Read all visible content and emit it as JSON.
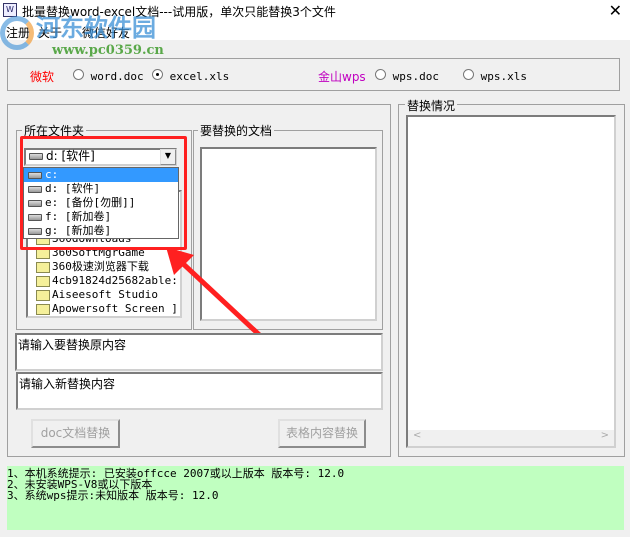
{
  "window": {
    "title": "批量替换word-excel文档---试用版，单次只能替换3个文件",
    "icon": "W",
    "close": "✕"
  },
  "watermark": {
    "name": "河东软件园",
    "url": "www.pc0359.cn"
  },
  "menu": [
    "注册",
    "关于",
    "微信好友"
  ],
  "format": {
    "ms_label": "微软",
    "wps_label": "金山wps",
    "options": [
      {
        "label": "word.doc",
        "checked": false
      },
      {
        "label": "excel.xls",
        "checked": true
      },
      {
        "label": "wps.doc",
        "checked": false
      },
      {
        "label": "wps.xls",
        "checked": false
      }
    ]
  },
  "folder_group": {
    "legend": "所在文件夹",
    "drive_selected": "d: [软件]",
    "drive_options": [
      "c:",
      "d: [软件]",
      "e: [备份[勿删]]",
      "f: [新加卷]",
      "g: [新加卷]"
    ],
    "folders": [
      "360downloads",
      "360SoftMgrGame",
      "360极速浏览器下载",
      "4cb91824d25682able:",
      "Aiseesoft Studio",
      "Apowersoft Screen ]"
    ]
  },
  "docs_group": {
    "legend": "要替换的文档"
  },
  "inputs": {
    "original_placeholder": "请输入要替换原内容",
    "new_placeholder": "请输入新替换内容"
  },
  "buttons": {
    "doc_replace": "doc文档替换",
    "table_replace": "表格内容替换"
  },
  "result_group": {
    "legend": "替换情况"
  },
  "status": [
    "1、本机系统提示: 已安装offcce 2007或以上版本 版本号: 12.0",
    "2、未安装WPS-V8或以下版本",
    "3、系统wps提示:未知版本 版本号: 12.0"
  ],
  "colors": {
    "ms": "#ff0000",
    "wps": "#c000c0",
    "status_bg": "#c0ffc0",
    "highlight": "#3399ff",
    "annotation": "#ff2020"
  }
}
